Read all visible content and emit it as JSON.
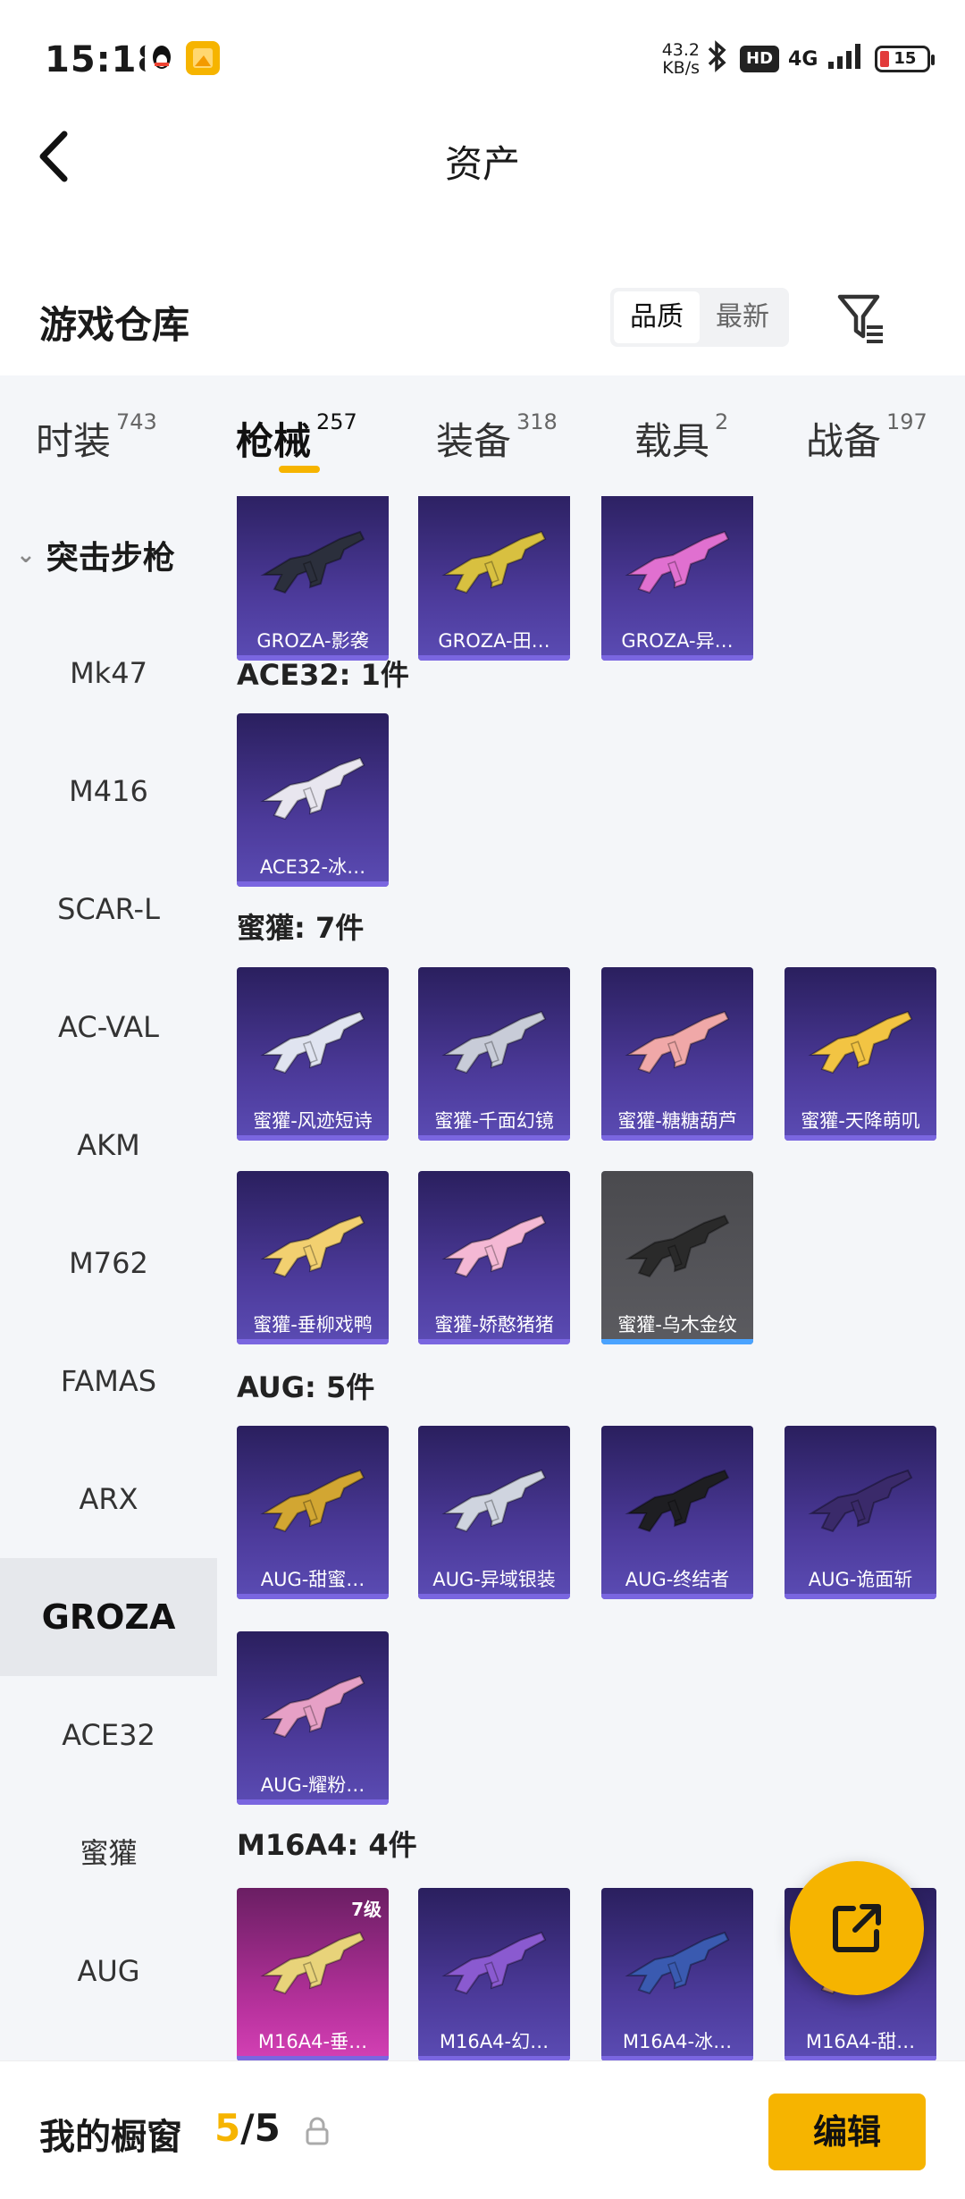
{
  "status_bar": {
    "time": "15:18",
    "net_speed_value": "43.2",
    "net_speed_unit": "KB/s",
    "hd": "HD",
    "network": "4G",
    "battery": "15"
  },
  "header": {
    "title": "资产"
  },
  "warehouse": {
    "title": "游戏仓库",
    "sort_options": [
      "品质",
      "最新"
    ],
    "sort_selected": "品质"
  },
  "tabs": [
    {
      "label": "时装",
      "count": "743"
    },
    {
      "label": "枪械",
      "count": "257",
      "active": true
    },
    {
      "label": "装备",
      "count": "318"
    },
    {
      "label": "载具",
      "count": "2"
    },
    {
      "label": "战备",
      "count": "197"
    }
  ],
  "sidebar": {
    "category": "突击步枪",
    "items": [
      "Mk47",
      "M416",
      "SCAR-L",
      "AC-VAL",
      "AKM",
      "M762",
      "FAMAS",
      "ARX",
      "GROZA",
      "ACE32",
      "蜜獾",
      "AUG"
    ],
    "active": "GROZA"
  },
  "sections": [
    {
      "title": "",
      "items": [
        {
          "label": "GROZA-影袭"
        },
        {
          "label": "GROZA-田…"
        },
        {
          "label": "GROZA-异…"
        }
      ]
    },
    {
      "title": "ACE32: 1件",
      "items": [
        {
          "label": "ACE32-冰…"
        }
      ]
    },
    {
      "title": "蜜獾: 7件",
      "items": [
        {
          "label": "蜜獾-风迹短诗"
        },
        {
          "label": "蜜獾-千面幻镜"
        },
        {
          "label": "蜜獾-糖糖葫芦"
        },
        {
          "label": "蜜獾-天降萌叽"
        },
        {
          "label": "蜜獾-垂柳戏鸭"
        },
        {
          "label": "蜜獾-娇憨猪猪"
        },
        {
          "label": "蜜獾-乌木金纹"
        }
      ]
    },
    {
      "title": "AUG: 5件",
      "items": [
        {
          "label": "AUG-甜蜜…"
        },
        {
          "label": "AUG-异域银装"
        },
        {
          "label": "AUG-终结者"
        },
        {
          "label": "AUG-诡面斩"
        },
        {
          "label": "AUG-耀粉…"
        }
      ]
    },
    {
      "title": "M16A4: 4件",
      "items": [
        {
          "label": "M16A4-垂…",
          "level": "7级"
        },
        {
          "label": "M16A4-幻…"
        },
        {
          "label": "M16A4-冰…"
        },
        {
          "label": "M16A4-甜…"
        }
      ]
    }
  ],
  "bottom_bar": {
    "label": "我的橱窗",
    "count_current": "5",
    "count_sep": "/",
    "count_total": "5",
    "edit_label": "编辑"
  },
  "colors": {
    "accent": "#f6b400",
    "card_purple": "#4c3a9a",
    "card_gray": "#55555a",
    "card_pink": "#b9329e"
  }
}
